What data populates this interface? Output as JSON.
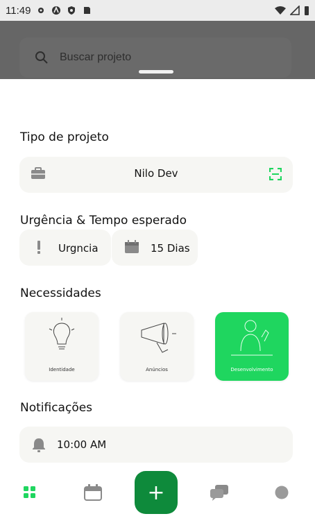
{
  "status_bar": {
    "time": "11:49"
  },
  "search": {
    "placeholder": "Buscar projeto"
  },
  "sections": {
    "project_type": "Tipo de projeto",
    "urgency": "Urgência & Tempo esperado",
    "needs": "Necessidades",
    "notifications": "Notificações"
  },
  "project_type": {
    "value": "Nilo Dev"
  },
  "urgency": {
    "label": "Urgncia",
    "days": "15 Dias"
  },
  "needs": [
    {
      "label": "Identidade",
      "active": false
    },
    {
      "label": "Anúncios",
      "active": false
    },
    {
      "label": "Desenvolvimento",
      "active": true
    }
  ],
  "notifications": {
    "time": "10:00 AM"
  },
  "bottom_nav": {
    "items": [
      "grid-icon",
      "calendar-icon",
      "add-icon",
      "chat-icon",
      "profile-icon"
    ],
    "fab_label": "+"
  },
  "colors": {
    "accent": "#1fd65f",
    "fab": "#0e8a3b",
    "card": "#f6f6f3"
  }
}
